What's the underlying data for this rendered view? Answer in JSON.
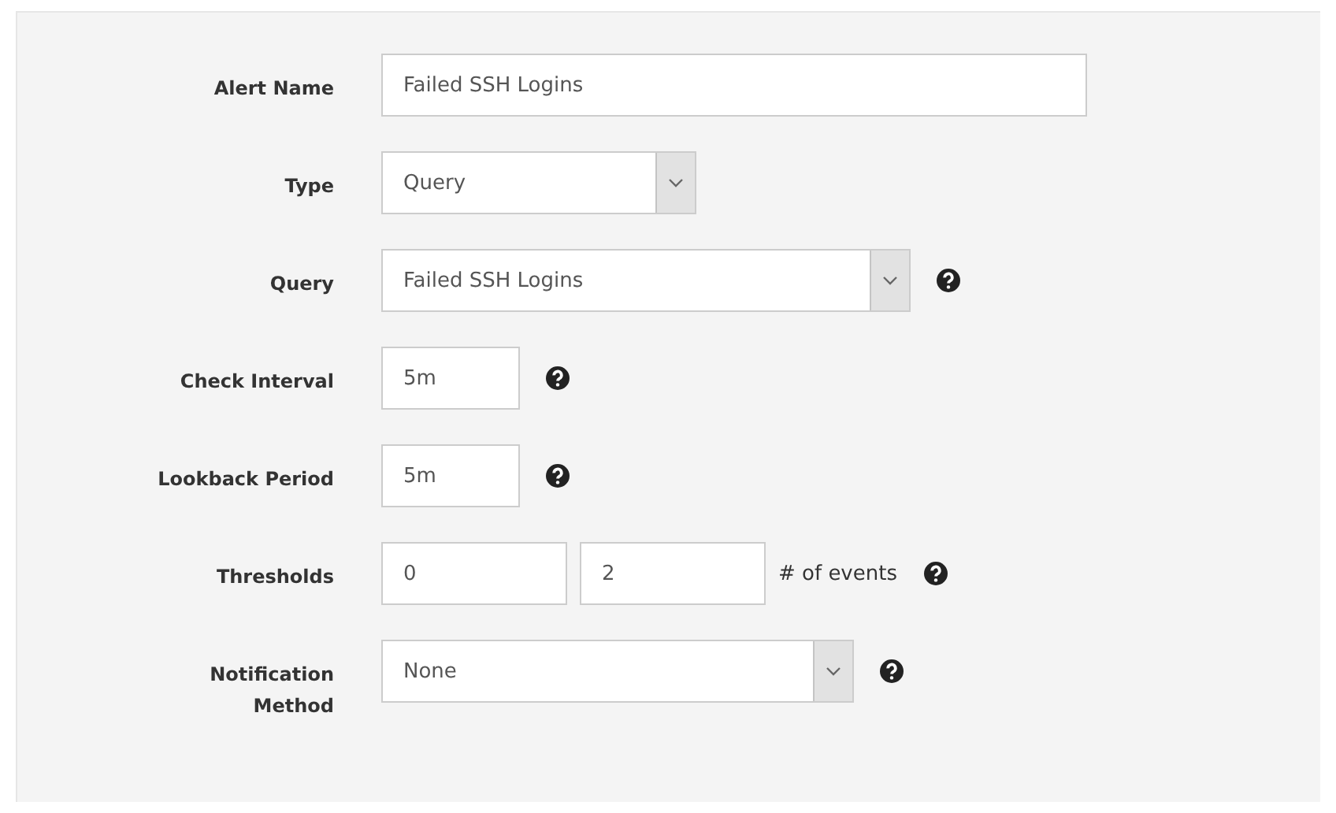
{
  "form": {
    "fields": [
      {
        "label": "Alert Name",
        "kind": "text",
        "values": [
          "Failed SSH Logins"
        ],
        "help": false
      },
      {
        "label": "Type",
        "kind": "select",
        "values": [
          "Query"
        ],
        "help": false
      },
      {
        "label": "Query",
        "kind": "select",
        "values": [
          "Failed SSH Logins"
        ],
        "help": true
      },
      {
        "label": "Check Interval",
        "kind": "text",
        "values": [
          "5m"
        ],
        "help": true
      },
      {
        "label": "Lookback Period",
        "kind": "text",
        "values": [
          "5m"
        ],
        "help": true
      },
      {
        "label": "Thresholds",
        "kind": "text",
        "values": [
          "0",
          "2"
        ],
        "suffix": "# of events",
        "help": true
      },
      {
        "label": "Notification Method",
        "kind": "select",
        "values": [
          "None"
        ],
        "help": true
      }
    ]
  }
}
